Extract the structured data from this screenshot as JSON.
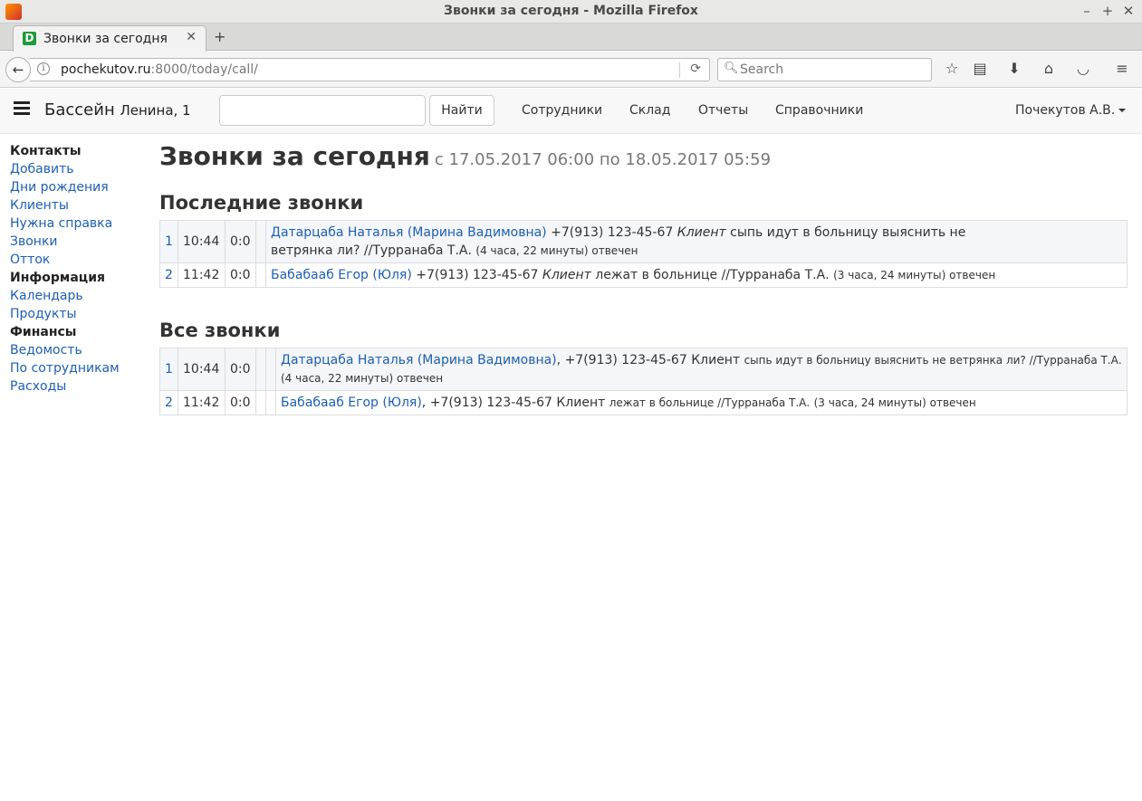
{
  "window": {
    "title": "Звонки за сегодня - Mozilla Firefox"
  },
  "tab": {
    "label": "Звонки за сегодня",
    "favicon_letter": "D"
  },
  "urlbar": {
    "host": "pochekutov.ru",
    "rest": ":8000/today/call/"
  },
  "searchbar": {
    "placeholder": "Search"
  },
  "header": {
    "brand": "Бассейн",
    "brand_small": "Ленина, 1",
    "search_button": "Найти",
    "nav": [
      "Сотрудники",
      "Склад",
      "Отчеты",
      "Справочники"
    ],
    "user": "Почекутов А.В."
  },
  "sidebar": {
    "sections": [
      {
        "title": "Контакты",
        "items": [
          "Добавить",
          "Дни рождения",
          "Клиенты",
          "Нужна справка",
          "Звонки",
          "Отток"
        ]
      },
      {
        "title": "Информация",
        "items": [
          "Календарь",
          "Продукты"
        ]
      },
      {
        "title": "Финансы",
        "items": [
          "Ведомость",
          "По сотрудникам",
          "Расходы"
        ]
      }
    ]
  },
  "page": {
    "title": "Звонки за сегодня",
    "subtitle": "с 17.05.2017 06:00 по 18.05.2017 05:59",
    "recent_heading": "Последние звонки",
    "all_heading": "Все звонки"
  },
  "recent_calls": [
    {
      "num": "1",
      "time": "10:44",
      "dur": "0:0",
      "contact": "Датарцаба Наталья (Марина Вадимовна)",
      "phone": "+7(913) 123-45-67",
      "type": "Клиент",
      "text": "сыпь идут в больницу выяснить не ветрянка ли? //Турранаба Т.А.",
      "meta": "(4 часа, 22 минуты) отвечен"
    },
    {
      "num": "2",
      "time": "11:42",
      "dur": "0:0",
      "contact": "Бабабааб Егор (Юля)",
      "phone": "+7(913) 123-45-67",
      "type": "Клиент",
      "text": "лежат в больнице //Турранаба Т.А.",
      "meta": "(3 часа, 24 минуты) отвечен"
    }
  ],
  "all_calls": [
    {
      "num": "1",
      "time": "10:44",
      "dur": "0:0",
      "contact": "Датарцаба Наталья (Марина Вадимовна)",
      "phone": "+7(913) 123-45-67",
      "type": "Клиент",
      "text": "сыпь идут в больницу выяснить не ветрянка ли? //Турранаба Т.А.",
      "meta": "(4 часа, 22 минуты) отвечен"
    },
    {
      "num": "2",
      "time": "11:42",
      "dur": "0:0",
      "contact": "Бабабааб Егор (Юля)",
      "phone": "+7(913) 123-45-67",
      "type": "Клиент",
      "text": "лежат в больнице //Турранаба Т.А.",
      "meta": "(3 часа, 24 минуты) отвечен"
    }
  ]
}
